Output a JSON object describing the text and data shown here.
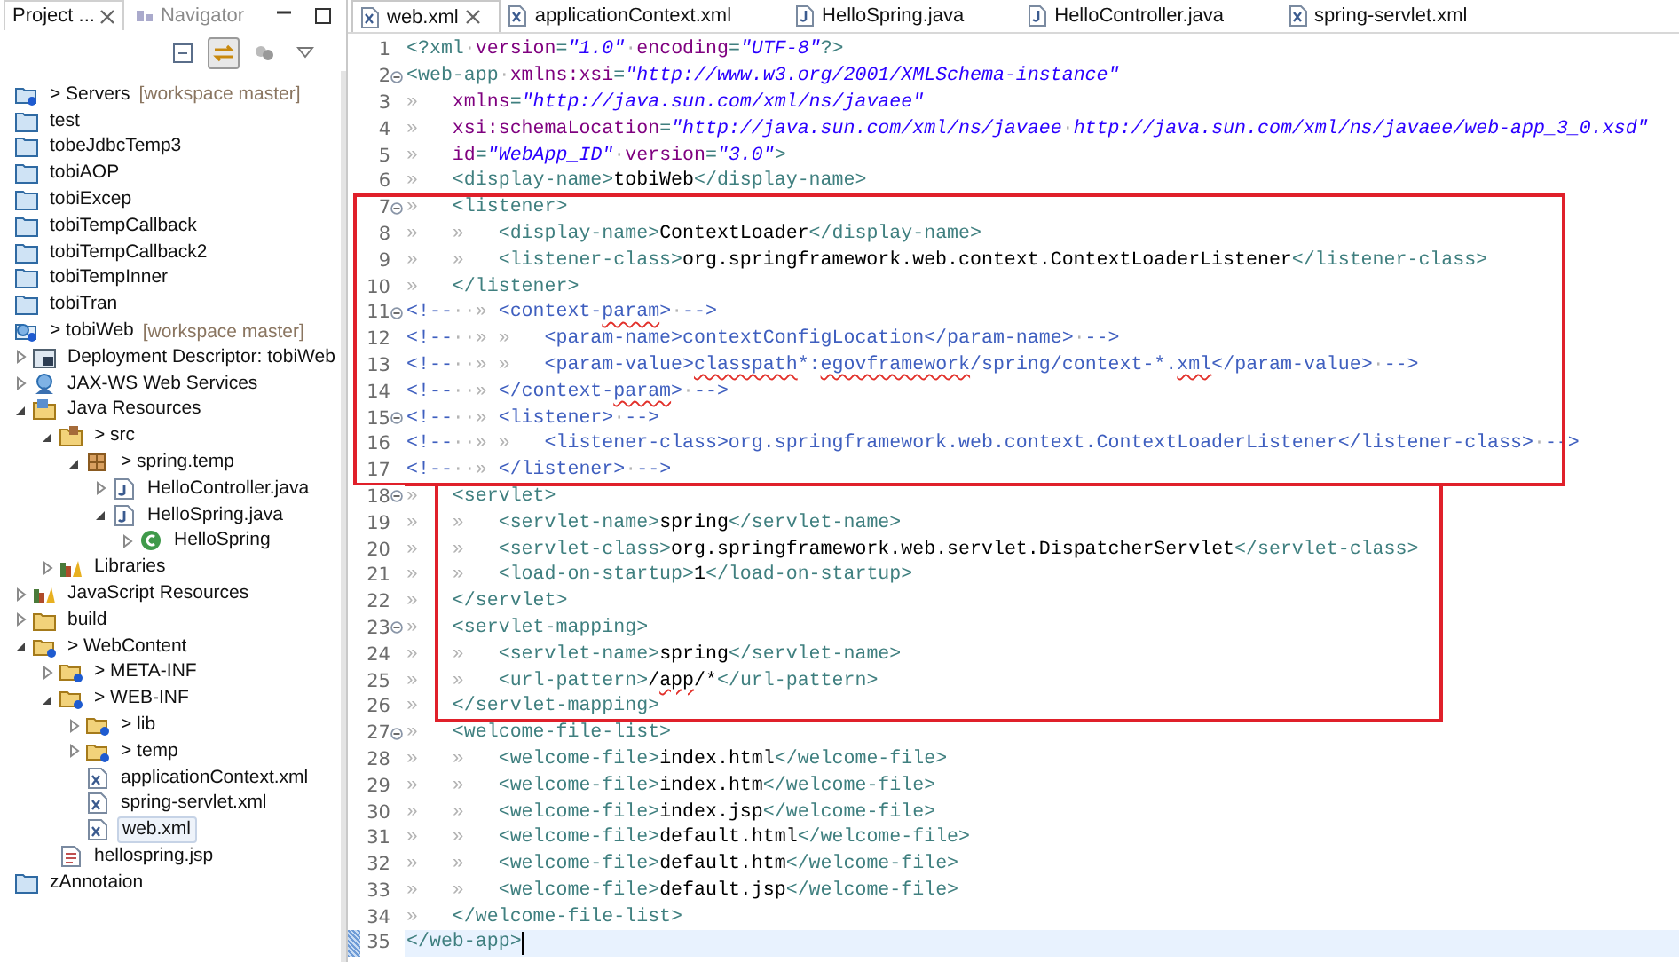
{
  "explorer": {
    "tabs": [
      {
        "label": "Project ...",
        "selected": true,
        "closable": true
      },
      {
        "label": "Navigator",
        "selected": false,
        "closable": false
      }
    ],
    "toolbar": [
      {
        "kind": "collapse",
        "pressed": false
      },
      {
        "kind": "link",
        "pressed": true
      },
      {
        "kind": "filter",
        "pressed": false
      },
      {
        "kind": "menu",
        "pressed": false
      }
    ],
    "tree": [
      {
        "label": "> Servers",
        "decoration": "[workspace master]",
        "kind": "shared-project",
        "selected": false
      },
      {
        "label": "test",
        "kind": "project",
        "selected": false
      },
      {
        "label": "tobeJdbcTemp3",
        "kind": "project",
        "selected": false
      },
      {
        "label": "tobiAOP",
        "kind": "project",
        "selected": false
      },
      {
        "label": "tobiExcep",
        "kind": "project",
        "selected": false
      },
      {
        "label": "tobiTempCallback",
        "kind": "project",
        "selected": false
      },
      {
        "label": "tobiTempCallback2",
        "kind": "project",
        "selected": false
      },
      {
        "label": "tobiTempInner",
        "kind": "project",
        "selected": false
      },
      {
        "label": "tobiTran",
        "kind": "project",
        "selected": false
      },
      {
        "label": "> tobiWeb",
        "decoration": "[workspace master]",
        "kind": "web-project",
        "selected": false,
        "children": [
          {
            "label": "Deployment Descriptor: tobiWeb",
            "kind": "descriptor",
            "expanded": false,
            "selected": false
          },
          {
            "label": "JAX-WS Web Services",
            "kind": "webservice",
            "expanded": false,
            "selected": false
          },
          {
            "label": "Java Resources",
            "kind": "resources",
            "expanded": true,
            "selected": false,
            "children": [
              {
                "label": "> src",
                "kind": "source-folder",
                "expanded": true,
                "selected": false,
                "children": [
                  {
                    "label": "> spring.temp",
                    "kind": "package",
                    "expanded": true,
                    "selected": false,
                    "children": [
                      {
                        "label": "HelloController.java",
                        "kind": "java",
                        "expanded": false,
                        "selected": false
                      },
                      {
                        "label": "HelloSpring.java",
                        "kind": "java",
                        "expanded": true,
                        "selected": false,
                        "children": [
                          {
                            "label": "HelloSpring",
                            "kind": "class",
                            "expanded": false,
                            "selected": false
                          }
                        ]
                      }
                    ]
                  }
                ]
              },
              {
                "label": "Libraries",
                "kind": "library",
                "expanded": false,
                "selected": false
              }
            ]
          },
          {
            "label": "JavaScript Resources",
            "kind": "library",
            "expanded": false,
            "selected": false
          },
          {
            "label": "build",
            "kind": "folder",
            "expanded": false,
            "selected": false
          },
          {
            "label": "> WebContent",
            "kind": "shared-folder",
            "expanded": true,
            "selected": false,
            "children": [
              {
                "label": "> META-INF",
                "kind": "shared-folder",
                "expanded": false,
                "selected": false
              },
              {
                "label": "> WEB-INF",
                "kind": "shared-folder",
                "expanded": true,
                "selected": false,
                "children": [
                  {
                    "label": "> lib",
                    "kind": "shared-folder",
                    "expanded": false,
                    "selected": false
                  },
                  {
                    "label": "> temp",
                    "kind": "shared-folder",
                    "expanded": false,
                    "selected": false
                  },
                  {
                    "label": "applicationContext.xml",
                    "kind": "xml",
                    "selected": false
                  },
                  {
                    "label": "spring-servlet.xml",
                    "kind": "xml",
                    "selected": false
                  },
                  {
                    "label": "web.xml",
                    "kind": "xml",
                    "selected": true
                  }
                ]
              },
              {
                "label": "hellospring.jsp",
                "kind": "jsp",
                "selected": false
              }
            ]
          }
        ]
      },
      {
        "label": "zAnnotaion",
        "kind": "project",
        "selected": false
      }
    ]
  },
  "editor": {
    "tabs": [
      {
        "label": "web.xml",
        "kind": "xml",
        "selected": true,
        "closable": true
      },
      {
        "label": "applicationContext.xml",
        "kind": "xml",
        "selected": false,
        "closable": false
      },
      {
        "label": "HelloSpring.java",
        "kind": "java",
        "selected": false,
        "closable": false
      },
      {
        "label": "HelloController.java",
        "kind": "java",
        "selected": false,
        "closable": false
      },
      {
        "label": "spring-servlet.xml",
        "kind": "xml",
        "selected": false,
        "closable": false
      }
    ],
    "blocks": [
      {
        "boxed": false,
        "lines": [
          {
            "number": "1",
            "fold": false,
            "current": false,
            "segments": [
              {
                "kind": "tag",
                "text": "<?xml"
              },
              {
                "kind": "ws",
                "text": "·"
              },
              {
                "kind": "attr",
                "text": "version"
              },
              {
                "kind": "tag",
                "text": "="
              },
              {
                "kind": "val",
                "text": "\"1.0\""
              },
              {
                "kind": "ws",
                "text": "·"
              },
              {
                "kind": "attr",
                "text": "encoding"
              },
              {
                "kind": "tag",
                "text": "="
              },
              {
                "kind": "val",
                "text": "\"UTF-8\""
              },
              {
                "kind": "tag",
                "text": "?>"
              }
            ]
          },
          {
            "number": "2",
            "fold": true,
            "current": false,
            "segments": [
              {
                "kind": "tag",
                "text": "<web-app"
              },
              {
                "kind": "ws",
                "text": "·"
              },
              {
                "kind": "attr",
                "text": "xmlns:xsi"
              },
              {
                "kind": "tag",
                "text": "="
              },
              {
                "kind": "val",
                "text": "\"http://www.w3.org/2001/XMLSchema-instance\""
              }
            ]
          },
          {
            "number": "3",
            "fold": false,
            "current": false,
            "segments": [
              {
                "kind": "ws",
                "text": "»   "
              },
              {
                "kind": "attr",
                "text": "xmlns"
              },
              {
                "kind": "tag",
                "text": "="
              },
              {
                "kind": "val",
                "text": "\"http://java.sun.com/xml/ns/javaee\""
              }
            ]
          },
          {
            "number": "4",
            "fold": false,
            "current": false,
            "segments": [
              {
                "kind": "ws",
                "text": "»   "
              },
              {
                "kind": "attr",
                "text": "xsi:schemaLocation"
              },
              {
                "kind": "tag",
                "text": "="
              },
              {
                "kind": "val",
                "text": "\"http://java.sun.com/xml/ns/javaee"
              },
              {
                "kind": "ws",
                "text": "·"
              },
              {
                "kind": "val",
                "text": "http://java.sun.com/xml/ns/javaee/web-app_3_0.xsd\""
              }
            ]
          },
          {
            "number": "5",
            "fold": false,
            "current": false,
            "segments": [
              {
                "kind": "ws",
                "text": "»   "
              },
              {
                "kind": "attr",
                "text": "id"
              },
              {
                "kind": "tag",
                "text": "="
              },
              {
                "kind": "val",
                "text": "\"WebApp_ID\""
              },
              {
                "kind": "ws",
                "text": "·"
              },
              {
                "kind": "attr",
                "text": "version"
              },
              {
                "kind": "tag",
                "text": "="
              },
              {
                "kind": "val",
                "text": "\"3.0\""
              },
              {
                "kind": "tag",
                "text": ">"
              }
            ]
          },
          {
            "number": "6",
            "fold": false,
            "current": false,
            "segments": [
              {
                "kind": "ws",
                "text": "»   "
              },
              {
                "kind": "tag",
                "text": "<display-name>"
              },
              {
                "kind": "text",
                "text": "tobiWeb"
              },
              {
                "kind": "tag",
                "text": "</display-name>"
              }
            ]
          }
        ]
      },
      {
        "boxed": true,
        "color": "#e0202a",
        "lines": [
          {
            "number": "7",
            "fold": true,
            "current": false,
            "segments": [
              {
                "kind": "ws",
                "text": "»   "
              },
              {
                "kind": "tag",
                "text": "<listener>"
              }
            ]
          },
          {
            "number": "8",
            "fold": false,
            "current": false,
            "segments": [
              {
                "kind": "ws",
                "text": "»   »   "
              },
              {
                "kind": "tag",
                "text": "<display-name>"
              },
              {
                "kind": "text",
                "text": "ContextLoader"
              },
              {
                "kind": "tag",
                "text": "</display-name>"
              }
            ]
          },
          {
            "number": "9",
            "fold": false,
            "current": false,
            "segments": [
              {
                "kind": "ws",
                "text": "»   »   "
              },
              {
                "kind": "tag",
                "text": "<listener-class>"
              },
              {
                "kind": "text",
                "text": "org.springframework.web.context.ContextLoaderListener"
              },
              {
                "kind": "tag",
                "text": "</listener-class>"
              }
            ]
          },
          {
            "number": "10",
            "fold": false,
            "current": false,
            "segments": [
              {
                "kind": "ws",
                "text": "»   "
              },
              {
                "kind": "tag",
                "text": "</listener>"
              }
            ]
          },
          {
            "number": "11",
            "fold": true,
            "current": false,
            "segments": [
              {
                "kind": "comment",
                "text": "<!--"
              },
              {
                "kind": "ws",
                "text": "··» "
              },
              {
                "kind": "comment",
                "text": "<context-"
              },
              {
                "kind": "comment_typo",
                "text": "param"
              },
              {
                "kind": "comment",
                "text": ">"
              },
              {
                "kind": "ws",
                "text": "·"
              },
              {
                "kind": "comment",
                "text": "-->"
              }
            ]
          },
          {
            "number": "12",
            "fold": false,
            "current": false,
            "segments": [
              {
                "kind": "comment",
                "text": "<!--"
              },
              {
                "kind": "ws",
                "text": "··» »   "
              },
              {
                "kind": "comment",
                "text": "<param-name>contextConfigLocation</param-name>"
              },
              {
                "kind": "ws",
                "text": "·"
              },
              {
                "kind": "comment",
                "text": "-->"
              }
            ]
          },
          {
            "number": "13",
            "fold": false,
            "current": false,
            "segments": [
              {
                "kind": "comment",
                "text": "<!--"
              },
              {
                "kind": "ws",
                "text": "··» »   "
              },
              {
                "kind": "comment",
                "text": "<param-value>"
              },
              {
                "kind": "comment_typo",
                "text": "classpath"
              },
              {
                "kind": "comment",
                "text": "*:"
              },
              {
                "kind": "comment_typo",
                "text": "egovframework"
              },
              {
                "kind": "comment",
                "text": "/spring/context-*."
              },
              {
                "kind": "comment_typo",
                "text": "xml"
              },
              {
                "kind": "comment",
                "text": "</param-value>"
              },
              {
                "kind": "ws",
                "text": "·"
              },
              {
                "kind": "comment",
                "text": "-->"
              }
            ]
          },
          {
            "number": "14",
            "fold": false,
            "current": false,
            "segments": [
              {
                "kind": "comment",
                "text": "<!--"
              },
              {
                "kind": "ws",
                "text": "··» "
              },
              {
                "kind": "comment",
                "text": "</context-"
              },
              {
                "kind": "comment_typo",
                "text": "param"
              },
              {
                "kind": "comment",
                "text": ">"
              },
              {
                "kind": "ws",
                "text": "·"
              },
              {
                "kind": "comment",
                "text": "-->"
              }
            ]
          },
          {
            "number": "15",
            "fold": true,
            "current": false,
            "segments": [
              {
                "kind": "comment",
                "text": "<!--"
              },
              {
                "kind": "ws",
                "text": "··» "
              },
              {
                "kind": "comment",
                "text": "<listener>"
              },
              {
                "kind": "ws",
                "text": "·"
              },
              {
                "kind": "comment",
                "text": "-->"
              }
            ]
          },
          {
            "number": "16",
            "fold": false,
            "current": false,
            "segments": [
              {
                "kind": "comment",
                "text": "<!--"
              },
              {
                "kind": "ws",
                "text": "··» »   "
              },
              {
                "kind": "comment",
                "text": "<listener-class>org.springframework.web.context.ContextLoaderListener</listener-class>"
              },
              {
                "kind": "ws",
                "text": "·"
              },
              {
                "kind": "comment",
                "text": "-->"
              }
            ]
          },
          {
            "number": "17",
            "fold": false,
            "current": false,
            "segments": [
              {
                "kind": "comment",
                "text": "<!--"
              },
              {
                "kind": "ws",
                "text": "··» "
              },
              {
                "kind": "comment",
                "text": "</listener>"
              },
              {
                "kind": "ws",
                "text": "·"
              },
              {
                "kind": "comment",
                "text": "-->"
              }
            ]
          }
        ]
      },
      {
        "boxed": true,
        "color": "#e0202a",
        "lines": [
          {
            "number": "18",
            "fold": true,
            "current": false,
            "segments": [
              {
                "kind": "ws",
                "text": "»   "
              },
              {
                "kind": "tag",
                "text": "<servlet>"
              }
            ]
          },
          {
            "number": "19",
            "fold": false,
            "current": false,
            "segments": [
              {
                "kind": "ws",
                "text": "»   »   "
              },
              {
                "kind": "tag",
                "text": "<servlet-name>"
              },
              {
                "kind": "text",
                "text": "spring"
              },
              {
                "kind": "tag",
                "text": "</servlet-name>"
              }
            ]
          },
          {
            "number": "20",
            "fold": false,
            "current": false,
            "segments": [
              {
                "kind": "ws",
                "text": "»   »   "
              },
              {
                "kind": "tag",
                "text": "<servlet-class>"
              },
              {
                "kind": "text",
                "text": "org.springframework.web.servlet.DispatcherServlet"
              },
              {
                "kind": "tag",
                "text": "</servlet-class>"
              }
            ]
          },
          {
            "number": "21",
            "fold": false,
            "current": false,
            "segments": [
              {
                "kind": "ws",
                "text": "»   »   "
              },
              {
                "kind": "tag",
                "text": "<load-on-startup>"
              },
              {
                "kind": "text",
                "text": "1"
              },
              {
                "kind": "tag",
                "text": "</load-on-startup>"
              }
            ]
          },
          {
            "number": "22",
            "fold": false,
            "current": false,
            "segments": [
              {
                "kind": "ws",
                "text": "»   "
              },
              {
                "kind": "tag",
                "text": "</servlet>"
              }
            ]
          },
          {
            "number": "23",
            "fold": true,
            "current": false,
            "segments": [
              {
                "kind": "ws",
                "text": "»   "
              },
              {
                "kind": "tag",
                "text": "<servlet-mapping>"
              }
            ]
          },
          {
            "number": "24",
            "fold": false,
            "current": false,
            "segments": [
              {
                "kind": "ws",
                "text": "»   »   "
              },
              {
                "kind": "tag",
                "text": "<servlet-name>"
              },
              {
                "kind": "text",
                "text": "spring"
              },
              {
                "kind": "tag",
                "text": "</servlet-name>"
              }
            ]
          },
          {
            "number": "25",
            "fold": false,
            "current": false,
            "segments": [
              {
                "kind": "ws",
                "text": "»   »   "
              },
              {
                "kind": "tag",
                "text": "<url-pattern>"
              },
              {
                "kind": "text",
                "text": "/"
              },
              {
                "kind": "text_typo",
                "text": "app"
              },
              {
                "kind": "text",
                "text": "/*"
              },
              {
                "kind": "tag",
                "text": "</url-pattern>"
              }
            ]
          },
          {
            "number": "26",
            "fold": false,
            "current": false,
            "segments": [
              {
                "kind": "ws",
                "text": "»   "
              },
              {
                "kind": "tag",
                "text": "</servlet-mapping>"
              }
            ]
          }
        ]
      },
      {
        "boxed": false,
        "lines": [
          {
            "number": "27",
            "fold": true,
            "current": false,
            "segments": [
              {
                "kind": "ws",
                "text": "»   "
              },
              {
                "kind": "tag",
                "text": "<welcome-file-list>"
              }
            ]
          },
          {
            "number": "28",
            "fold": false,
            "current": false,
            "segments": [
              {
                "kind": "ws",
                "text": "»   »   "
              },
              {
                "kind": "tag",
                "text": "<welcome-file>"
              },
              {
                "kind": "text",
                "text": "index.html"
              },
              {
                "kind": "tag",
                "text": "</welcome-file>"
              }
            ]
          },
          {
            "number": "29",
            "fold": false,
            "current": false,
            "segments": [
              {
                "kind": "ws",
                "text": "»   »   "
              },
              {
                "kind": "tag",
                "text": "<welcome-file>"
              },
              {
                "kind": "text",
                "text": "index.htm"
              },
              {
                "kind": "tag",
                "text": "</welcome-file>"
              }
            ]
          },
          {
            "number": "30",
            "fold": false,
            "current": false,
            "segments": [
              {
                "kind": "ws",
                "text": "»   »   "
              },
              {
                "kind": "tag",
                "text": "<welcome-file>"
              },
              {
                "kind": "text",
                "text": "index.jsp"
              },
              {
                "kind": "tag",
                "text": "</welcome-file>"
              }
            ]
          },
          {
            "number": "31",
            "fold": false,
            "current": false,
            "segments": [
              {
                "kind": "ws",
                "text": "»   »   "
              },
              {
                "kind": "tag",
                "text": "<welcome-file>"
              },
              {
                "kind": "text",
                "text": "default.html"
              },
              {
                "kind": "tag",
                "text": "</welcome-file>"
              }
            ]
          },
          {
            "number": "32",
            "fold": false,
            "current": false,
            "segments": [
              {
                "kind": "ws",
                "text": "»   »   "
              },
              {
                "kind": "tag",
                "text": "<welcome-file>"
              },
              {
                "kind": "text",
                "text": "default.htm"
              },
              {
                "kind": "tag",
                "text": "</welcome-file>"
              }
            ]
          },
          {
            "number": "33",
            "fold": false,
            "current": false,
            "segments": [
              {
                "kind": "ws",
                "text": "»   »   "
              },
              {
                "kind": "tag",
                "text": "<welcome-file>"
              },
              {
                "kind": "text",
                "text": "default.jsp"
              },
              {
                "kind": "tag",
                "text": "</welcome-file>"
              }
            ]
          },
          {
            "number": "34",
            "fold": false,
            "current": false,
            "segments": [
              {
                "kind": "ws",
                "text": "»   "
              },
              {
                "kind": "tag",
                "text": "</welcome-file-list>"
              }
            ]
          },
          {
            "number": "35",
            "fold": false,
            "current": true,
            "segments": [
              {
                "kind": "tag",
                "text": "</web-app>"
              }
            ]
          }
        ]
      }
    ]
  }
}
